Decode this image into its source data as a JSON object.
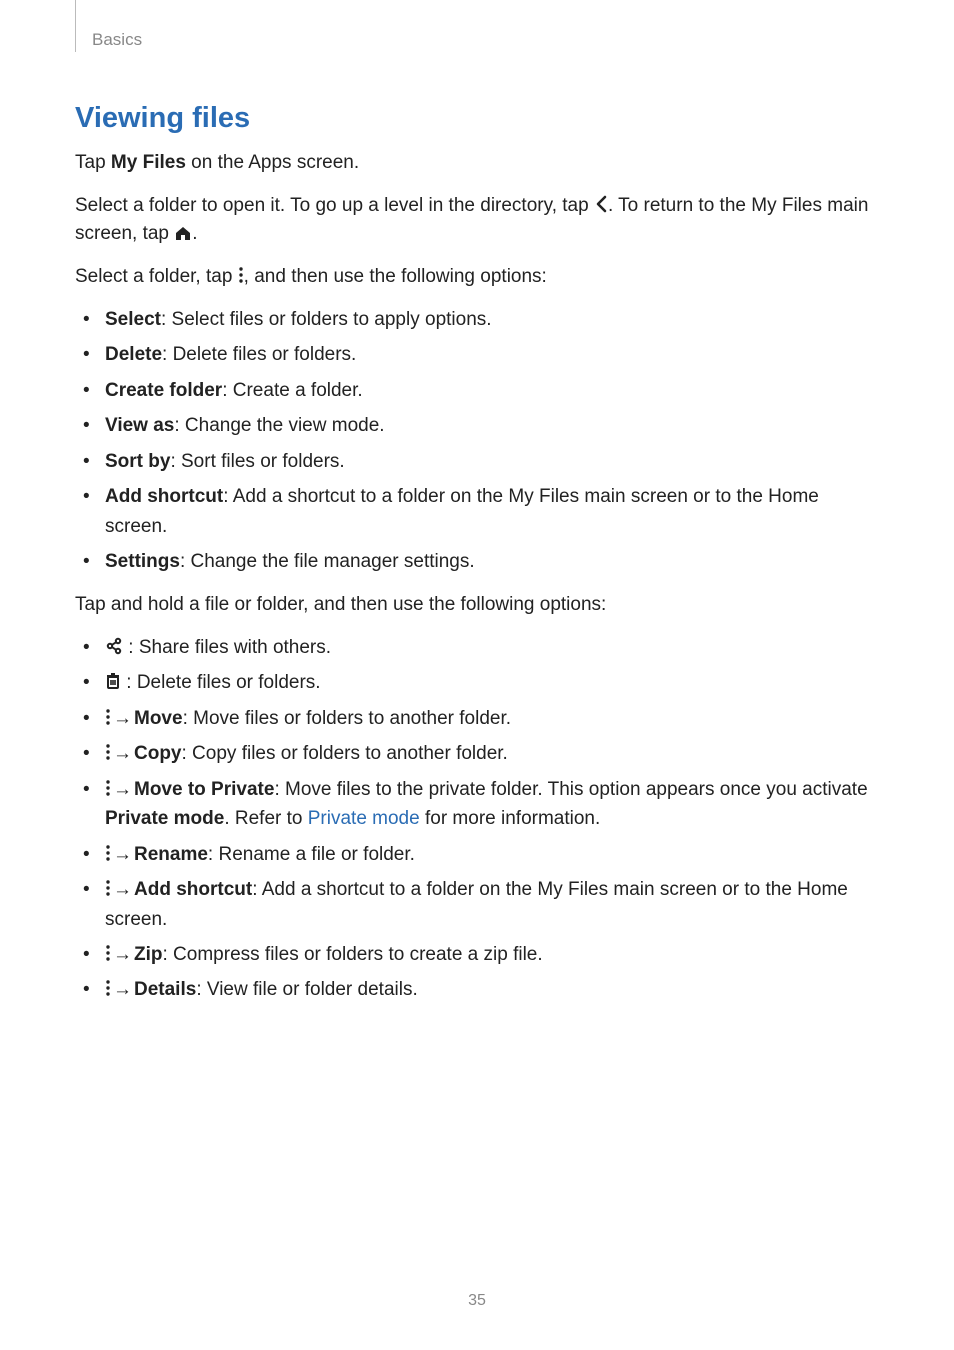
{
  "header": {
    "breadcrumb": "Basics"
  },
  "section": {
    "title": "Viewing files"
  },
  "p1": {
    "t1": "Tap ",
    "b1": "My Files",
    "t2": " on the Apps screen."
  },
  "p2": {
    "t1": "Select a folder to open it. To go up a level in the directory, tap ",
    "t2": ". To return to the My Files main screen, tap ",
    "t3": "."
  },
  "p3": {
    "t1": "Select a folder, tap ",
    "t2": ", and then use the following options:"
  },
  "list1": {
    "i0": {
      "b": "Select",
      "t": ": Select files or folders to apply options."
    },
    "i1": {
      "b": "Delete",
      "t": ": Delete files or folders."
    },
    "i2": {
      "b": "Create folder",
      "t": ": Create a folder."
    },
    "i3": {
      "b": "View as",
      "t": ": Change the view mode."
    },
    "i4": {
      "b": "Sort by",
      "t": ": Sort files or folders."
    },
    "i5": {
      "b": "Add shortcut",
      "t": ": Add a shortcut to a folder on the My Files main screen or to the Home screen."
    },
    "i6": {
      "b": "Settings",
      "t": ": Change the file manager settings."
    }
  },
  "p4": {
    "t1": "Tap and hold a file or folder, and then use the following options:"
  },
  "list2": {
    "i0": {
      "t": " : Share files with others."
    },
    "i1": {
      "t": " : Delete files or folders."
    },
    "i2": {
      "arrow": " → ",
      "b": "Move",
      "t": ": Move files or folders to another folder."
    },
    "i3": {
      "arrow": " → ",
      "b": "Copy",
      "t": ": Copy files or folders to another folder."
    },
    "i4": {
      "arrow": " → ",
      "b": "Move to Private",
      "t1": ": Move files to the private folder. This option appears once you activate ",
      "b2": "Private mode",
      "t2": ". Refer to ",
      "link": "Private mode",
      "t3": " for more information."
    },
    "i5": {
      "arrow": " → ",
      "b": "Rename",
      "t": ": Rename a file or folder."
    },
    "i6": {
      "arrow": " → ",
      "b": "Add shortcut",
      "t": ": Add a shortcut to a folder on the My Files main screen or to the Home screen."
    },
    "i7": {
      "arrow": " → ",
      "b": "Zip",
      "t": ": Compress files or folders to create a zip file."
    },
    "i8": {
      "arrow": " → ",
      "b": "Details",
      "t": ": View file or folder details."
    }
  },
  "page_number": "35"
}
